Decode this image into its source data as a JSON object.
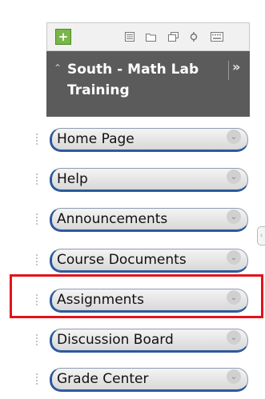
{
  "toolbar": {
    "add_glyph": "+",
    "icons": [
      "list-icon",
      "folder-icon",
      "window-icon",
      "refresh-icon",
      "keyboard-icon"
    ]
  },
  "course": {
    "collapse_glyph": "»",
    "title": "South - Math Lab Training"
  },
  "nav": {
    "items": [
      {
        "label": "Home Page"
      },
      {
        "label": "Help"
      },
      {
        "label": "Announcements"
      },
      {
        "label": "Course Documents"
      },
      {
        "label": "Assignments"
      },
      {
        "label": "Discussion Board"
      },
      {
        "label": "Grade Center"
      }
    ]
  },
  "colors": {
    "header_bg": "#5b5b5b",
    "add_button": "#7ab648",
    "nav_accent": "#2d5a9c",
    "highlight": "#e3131b"
  }
}
